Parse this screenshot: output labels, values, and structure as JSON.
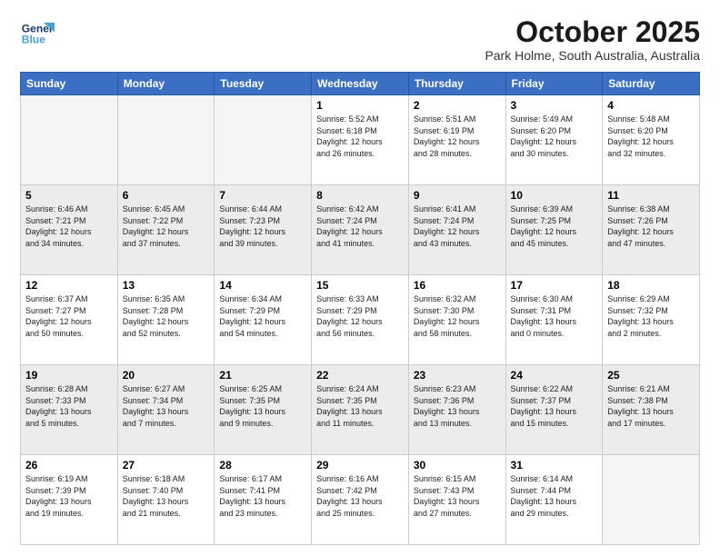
{
  "header": {
    "logo_line1": "General",
    "logo_line2": "Blue",
    "month": "October 2025",
    "location": "Park Holme, South Australia, Australia"
  },
  "days_of_week": [
    "Sunday",
    "Monday",
    "Tuesday",
    "Wednesday",
    "Thursday",
    "Friday",
    "Saturday"
  ],
  "weeks": [
    [
      {
        "num": "",
        "info": ""
      },
      {
        "num": "",
        "info": ""
      },
      {
        "num": "",
        "info": ""
      },
      {
        "num": "1",
        "info": "Sunrise: 5:52 AM\nSunset: 6:18 PM\nDaylight: 12 hours\nand 26 minutes."
      },
      {
        "num": "2",
        "info": "Sunrise: 5:51 AM\nSunset: 6:19 PM\nDaylight: 12 hours\nand 28 minutes."
      },
      {
        "num": "3",
        "info": "Sunrise: 5:49 AM\nSunset: 6:20 PM\nDaylight: 12 hours\nand 30 minutes."
      },
      {
        "num": "4",
        "info": "Sunrise: 5:48 AM\nSunset: 6:20 PM\nDaylight: 12 hours\nand 32 minutes."
      }
    ],
    [
      {
        "num": "5",
        "info": "Sunrise: 6:46 AM\nSunset: 7:21 PM\nDaylight: 12 hours\nand 34 minutes."
      },
      {
        "num": "6",
        "info": "Sunrise: 6:45 AM\nSunset: 7:22 PM\nDaylight: 12 hours\nand 37 minutes."
      },
      {
        "num": "7",
        "info": "Sunrise: 6:44 AM\nSunset: 7:23 PM\nDaylight: 12 hours\nand 39 minutes."
      },
      {
        "num": "8",
        "info": "Sunrise: 6:42 AM\nSunset: 7:24 PM\nDaylight: 12 hours\nand 41 minutes."
      },
      {
        "num": "9",
        "info": "Sunrise: 6:41 AM\nSunset: 7:24 PM\nDaylight: 12 hours\nand 43 minutes."
      },
      {
        "num": "10",
        "info": "Sunrise: 6:39 AM\nSunset: 7:25 PM\nDaylight: 12 hours\nand 45 minutes."
      },
      {
        "num": "11",
        "info": "Sunrise: 6:38 AM\nSunset: 7:26 PM\nDaylight: 12 hours\nand 47 minutes."
      }
    ],
    [
      {
        "num": "12",
        "info": "Sunrise: 6:37 AM\nSunset: 7:27 PM\nDaylight: 12 hours\nand 50 minutes."
      },
      {
        "num": "13",
        "info": "Sunrise: 6:35 AM\nSunset: 7:28 PM\nDaylight: 12 hours\nand 52 minutes."
      },
      {
        "num": "14",
        "info": "Sunrise: 6:34 AM\nSunset: 7:29 PM\nDaylight: 12 hours\nand 54 minutes."
      },
      {
        "num": "15",
        "info": "Sunrise: 6:33 AM\nSunset: 7:29 PM\nDaylight: 12 hours\nand 56 minutes."
      },
      {
        "num": "16",
        "info": "Sunrise: 6:32 AM\nSunset: 7:30 PM\nDaylight: 12 hours\nand 58 minutes."
      },
      {
        "num": "17",
        "info": "Sunrise: 6:30 AM\nSunset: 7:31 PM\nDaylight: 13 hours\nand 0 minutes."
      },
      {
        "num": "18",
        "info": "Sunrise: 6:29 AM\nSunset: 7:32 PM\nDaylight: 13 hours\nand 2 minutes."
      }
    ],
    [
      {
        "num": "19",
        "info": "Sunrise: 6:28 AM\nSunset: 7:33 PM\nDaylight: 13 hours\nand 5 minutes."
      },
      {
        "num": "20",
        "info": "Sunrise: 6:27 AM\nSunset: 7:34 PM\nDaylight: 13 hours\nand 7 minutes."
      },
      {
        "num": "21",
        "info": "Sunrise: 6:25 AM\nSunset: 7:35 PM\nDaylight: 13 hours\nand 9 minutes."
      },
      {
        "num": "22",
        "info": "Sunrise: 6:24 AM\nSunset: 7:35 PM\nDaylight: 13 hours\nand 11 minutes."
      },
      {
        "num": "23",
        "info": "Sunrise: 6:23 AM\nSunset: 7:36 PM\nDaylight: 13 hours\nand 13 minutes."
      },
      {
        "num": "24",
        "info": "Sunrise: 6:22 AM\nSunset: 7:37 PM\nDaylight: 13 hours\nand 15 minutes."
      },
      {
        "num": "25",
        "info": "Sunrise: 6:21 AM\nSunset: 7:38 PM\nDaylight: 13 hours\nand 17 minutes."
      }
    ],
    [
      {
        "num": "26",
        "info": "Sunrise: 6:19 AM\nSunset: 7:39 PM\nDaylight: 13 hours\nand 19 minutes."
      },
      {
        "num": "27",
        "info": "Sunrise: 6:18 AM\nSunset: 7:40 PM\nDaylight: 13 hours\nand 21 minutes."
      },
      {
        "num": "28",
        "info": "Sunrise: 6:17 AM\nSunset: 7:41 PM\nDaylight: 13 hours\nand 23 minutes."
      },
      {
        "num": "29",
        "info": "Sunrise: 6:16 AM\nSunset: 7:42 PM\nDaylight: 13 hours\nand 25 minutes."
      },
      {
        "num": "30",
        "info": "Sunrise: 6:15 AM\nSunset: 7:43 PM\nDaylight: 13 hours\nand 27 minutes."
      },
      {
        "num": "31",
        "info": "Sunrise: 6:14 AM\nSunset: 7:44 PM\nDaylight: 13 hours\nand 29 minutes."
      },
      {
        "num": "",
        "info": ""
      }
    ]
  ]
}
